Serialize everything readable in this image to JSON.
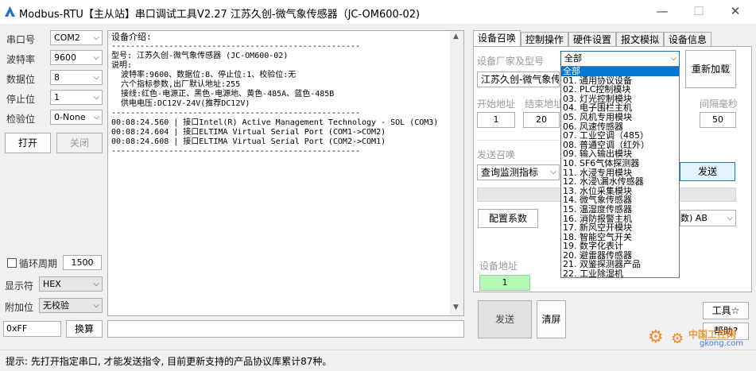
{
  "window": {
    "title": "Modbus-RTU【主从站】串口调试工具V2.27 江苏久创-微气象传感器（JC-OM600-02)",
    "minimize_glyph": "—",
    "maximize_glyph": "☐",
    "close_glyph": "✕"
  },
  "serial": {
    "port_label": "串口号",
    "port_value": "COM2",
    "baud_label": "波特率",
    "baud_value": "9600",
    "data_label": "数据位",
    "data_value": "8",
    "stop_label": "停止位",
    "stop_value": "1",
    "parity_label": "检验位",
    "parity_value": "0-None",
    "open_button": "打开",
    "close_button": "关闭",
    "loop_label": "循环周期",
    "loop_value": "1500",
    "display_label": "显示符",
    "display_value": "HEX",
    "append_label": "附加位",
    "append_value": "无校验",
    "conv_input": "0xFF",
    "conv_button": "换算"
  },
  "device": {
    "heading": "设备介绍:",
    "divider": "----------------------------------------------------",
    "lines": [
      "型号: 江苏久创-微气象传感器 (JC-OM600-02)",
      "说明:",
      "  波特率:9600、数据位:8、停止位:1、校验位:无",
      "  六个指标参数,出厂默认地址:255",
      "  接线:红色-电源正、黑色-电源地、黄色-485A、蓝色-485B",
      "  供电电压:DC12V-24V(推荐DC12V)"
    ],
    "log": [
      "00:08:24.560 | 接口Intel(R) Active Management Technology - SOL (COM3)",
      "00:08:24.604 | 接口ELTIMA Virtual Serial Port (COM1->COM2)",
      "00:08:24.608 | 接口ELTIMA Virtual Serial Port (COM2->COM1)"
    ]
  },
  "tabs": [
    "设备召唤",
    "控制操作",
    "硬件设置",
    "报文模拟",
    "设备信息"
  ],
  "panel": {
    "vendor_label": "设备厂家及型号",
    "category_value": "全部",
    "model_value": "江苏久创-微气象传",
    "reload_button": "重新加载",
    "start_label": "开始地址",
    "start_value": "1",
    "end_label": "结束地址",
    "end_value": "20",
    "interval_label": "间隔毫秒",
    "interval_value": "50",
    "send_call_label": "发送召唤",
    "query_value": "查询监测指标",
    "send_button": "发送",
    "config_button": "配置系数",
    "byte_order_value": "数) AB",
    "dev_addr_label": "设备地址",
    "dev_addr_value": "1",
    "big_send_button": "发送",
    "clear_button": "清屏",
    "tools_button": "工具☆",
    "help_button": "帮助?"
  },
  "dropdown_options": [
    "全部",
    "01. 通用协议设备",
    "02. PLC控制模块",
    "03. 灯光控制模块",
    "04. 电子围栏主机",
    "05. 风机专用模块",
    "06. 风速传感器",
    "07. 工业空调（485）",
    "08. 普通空调（红外）",
    "09. 输入输出模块",
    "10. SF6气体探测器",
    "11. 水浸专用模块",
    "12. 水浸\\漏水传感器",
    "13. 水位采集模块",
    "14. 微气象传感器",
    "15. 温湿度传感器",
    "16. 消防报警主机",
    "17. 新风空开模块",
    "18. 智能空气开关",
    "19. 数字化表计",
    "20. 避雷器传感器",
    "21. 双鉴探测器产品",
    "22. 工业除湿机"
  ],
  "status": {
    "text": "提示: 先打开指定串口, 才能发送指令, 目前更新支持的产品协议库累计87种。"
  },
  "watermark": {
    "site": "中国工控网",
    "url": "gkong.com"
  },
  "colors": {
    "selected": "#0078d7",
    "green_field": "#b5f7b5",
    "accent_orange": "#f28a1c"
  }
}
